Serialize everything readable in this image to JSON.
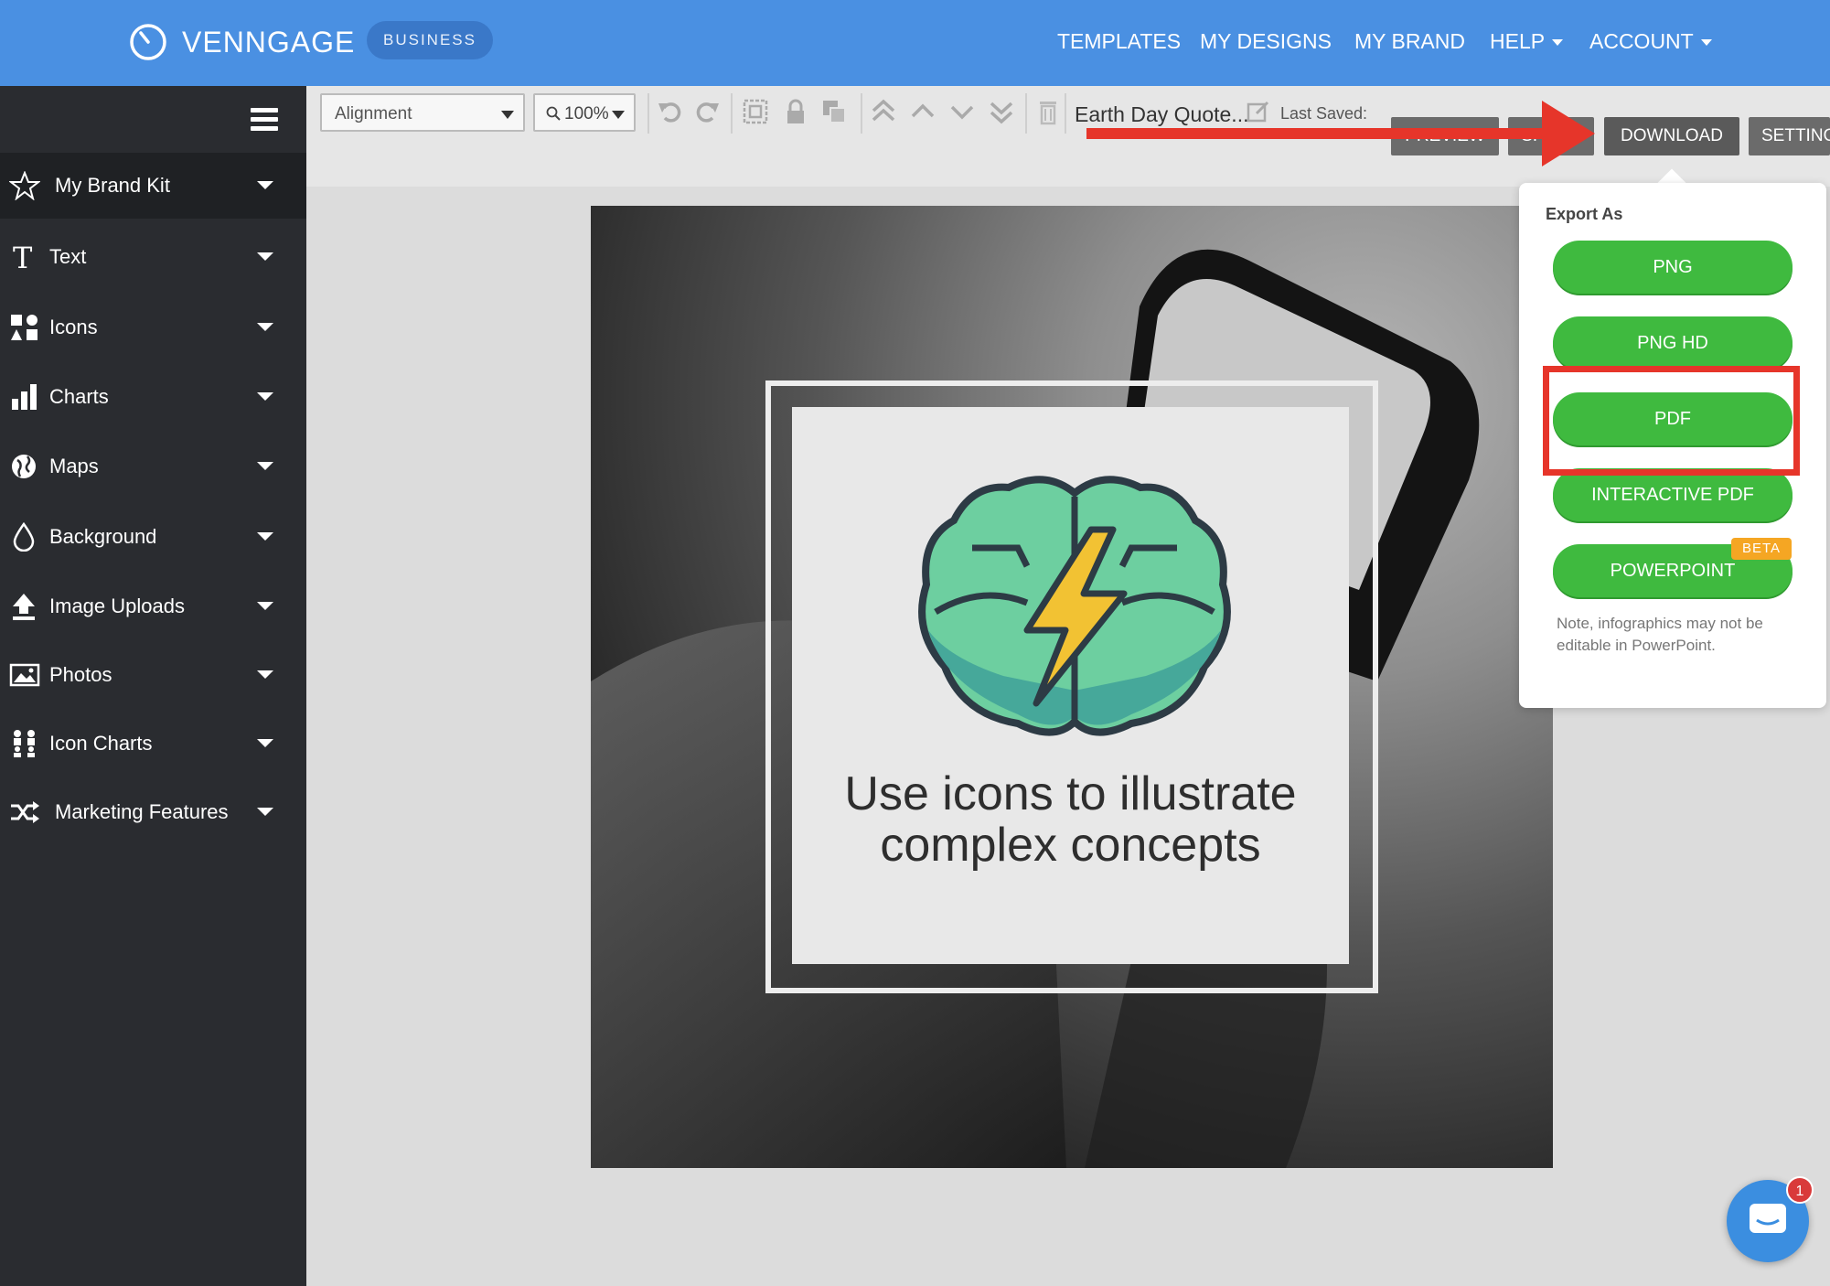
{
  "brand": {
    "name": "VENNGAGE",
    "plan_badge": "BUSINESS"
  },
  "nav": {
    "templates": "TEMPLATES",
    "my_designs": "MY DESIGNS",
    "my_brand": "MY BRAND",
    "help": "HELP",
    "account": "ACCOUNT"
  },
  "sidebar": {
    "items": [
      {
        "label": "My Brand Kit",
        "icon": "star-icon"
      },
      {
        "label": "Text",
        "icon": "text-icon"
      },
      {
        "label": "Icons",
        "icon": "shapes-icon"
      },
      {
        "label": "Charts",
        "icon": "bar-chart-icon"
      },
      {
        "label": "Maps",
        "icon": "globe-icon"
      },
      {
        "label": "Background",
        "icon": "drop-icon"
      },
      {
        "label": "Image Uploads",
        "icon": "upload-icon"
      },
      {
        "label": "Photos",
        "icon": "image-icon"
      },
      {
        "label": "Icon Charts",
        "icon": "people-icon"
      },
      {
        "label": "Marketing Features",
        "icon": "shuffle-icon"
      }
    ]
  },
  "toolbar": {
    "alignment": "Alignment",
    "zoom": "100%",
    "doc_title": "Earth Day Quote...",
    "last_saved": "Last Saved:",
    "preview_btn": "PREVIEW",
    "share_btn": "SHARE",
    "download_btn": "DOWNLOAD",
    "settings_btn": "SETTINGS"
  },
  "canvas": {
    "headline_line1": "Use icons to illustrate",
    "headline_line2": "complex concepts"
  },
  "export": {
    "title": "Export As",
    "options": [
      "PNG",
      "PNG HD",
      "PDF",
      "INTERACTIVE PDF",
      "POWERPOINT"
    ],
    "beta_badge": "BETA",
    "note": "Note, infographics may not be editable in PowerPoint."
  },
  "chat": {
    "unread_count": "1"
  },
  "colors": {
    "nav_blue": "#4a90e2",
    "sidebar_dark": "#2a2c30",
    "export_green": "#3fba3f",
    "annotation_red": "#e6352a",
    "beta_orange": "#f5a623"
  }
}
